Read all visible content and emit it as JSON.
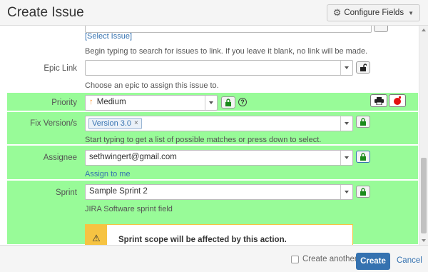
{
  "header": {
    "title": "Create Issue",
    "configure_label": "Configure Fields"
  },
  "linked_issue": {
    "select_issue_link": "[Select Issue]",
    "help": "Begin typing to search for issues to link. If you leave it blank, no link will be made."
  },
  "epic_link": {
    "label": "Epic Link",
    "value": "",
    "help": "Choose an epic to assign this issue to."
  },
  "priority": {
    "label": "Priority",
    "value": "Medium",
    "icon": "arrow-up-icon",
    "icon_color": "#f79232"
  },
  "fix_version": {
    "label": "Fix Version/s",
    "tag": "Version 3.0",
    "remove": "×",
    "help": "Start typing to get a list of possible matches or press down to select."
  },
  "assignee": {
    "label": "Assignee",
    "value": "sethwingert@gmail.com",
    "assign_to_me": "Assign to me"
  },
  "sprint": {
    "label": "Sprint",
    "value": "Sample Sprint 2",
    "help": "JIRA Software sprint field"
  },
  "warning": {
    "text": "Sprint scope will be affected by this action.",
    "icon": "⚠"
  },
  "footer": {
    "create_another": "Create another",
    "create": "Create",
    "cancel": "Cancel"
  },
  "colors": {
    "highlight": "#98fb98",
    "link": "#3572b0",
    "primary_button": "#3572b0",
    "warning": "#f6c342"
  }
}
